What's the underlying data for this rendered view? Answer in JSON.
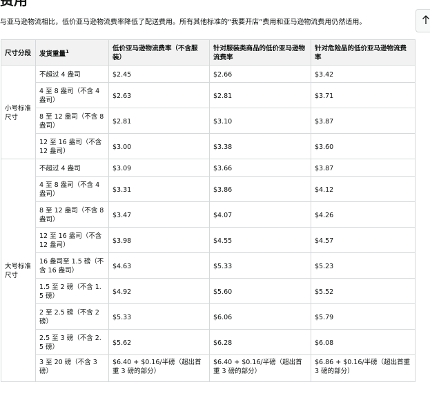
{
  "page": {
    "title": "费用",
    "intro": "与亚马逊物流相比，低价亚马逊物流费率降低了配送费用。所有其他标准的“我要开店”费用和亚马逊物流费用仍然适用。"
  },
  "scroll_top_icon": "arrow-up-icon",
  "table": {
    "headers": {
      "size": "尺寸分段",
      "weight": "发货重量",
      "weight_sup": "1",
      "low_price": "低价亚马逊物流费率（不含服装）",
      "apparel": "针对服装类商品的低价亚马逊物流费率",
      "dangerous": "针对危险品的低价亚马逊物流费率"
    },
    "groups": [
      {
        "label": "小号标准尺寸",
        "rows": [
          {
            "weight": "不超过 4 盎司",
            "low_price": "$2.45",
            "apparel": "$2.66",
            "dangerous": "$3.42"
          },
          {
            "weight": "4 至 8 盎司（不含 4 盎司）",
            "low_price": "$2.63",
            "apparel": "$2.81",
            "dangerous": "$3.71"
          },
          {
            "weight": "8 至 12 盎司（不含 8 盎司）",
            "low_price": "$2.81",
            "apparel": "$3.10",
            "dangerous": "$3.87"
          },
          {
            "weight": "12 至 16 盎司（不含 12 盎司）",
            "low_price": "$3.00",
            "apparel": "$3.38",
            "dangerous": "$3.60"
          }
        ]
      },
      {
        "label": "大号标准尺寸",
        "rows": [
          {
            "weight": "不超过 4 盎司",
            "low_price": "$3.09",
            "apparel": "$3.66",
            "dangerous": "$3.87"
          },
          {
            "weight": "4 至 8 盎司（不含 4 盎司）",
            "low_price": "$3.31",
            "apparel": "$3.86",
            "dangerous": "$4.12"
          },
          {
            "weight": "8 至 12 盎司（不含 8 盎司）",
            "low_price": "$3.47",
            "apparel": "$4.07",
            "dangerous": "$4.26"
          },
          {
            "weight": "12 至 16 盎司（不含 12 盎司）",
            "low_price": "$3.98",
            "apparel": "$4.55",
            "dangerous": "$4.57"
          },
          {
            "weight": "16 盎司至 1.5 磅（不含 16 盎司）",
            "low_price": "$4.63",
            "apparel": "$5.33",
            "dangerous": "$5.23"
          },
          {
            "weight": "1.5 至 2 磅（不含 1.5 磅）",
            "low_price": "$4.92",
            "apparel": "$5.60",
            "dangerous": "$5.52"
          },
          {
            "weight": "2 至 2.5 磅（不含 2 磅）",
            "low_price": "$5.33",
            "apparel": "$6.06",
            "dangerous": "$5.79"
          },
          {
            "weight": "2.5 至 3 磅（不含 2.5 磅）",
            "low_price": "$5.62",
            "apparel": "$6.28",
            "dangerous": "$6.08"
          },
          {
            "weight": "3 至 20 磅（不含 3 磅）",
            "low_price": "$6.40 + $0.16/半磅（超出首重 3 磅的部分）",
            "apparel": "$6.40 + $0.16/半磅（超出首重 3 磅的部分）",
            "dangerous": "$6.86 + $0.16/半磅（超出首重 3 磅的部分）"
          }
        ]
      }
    ]
  }
}
